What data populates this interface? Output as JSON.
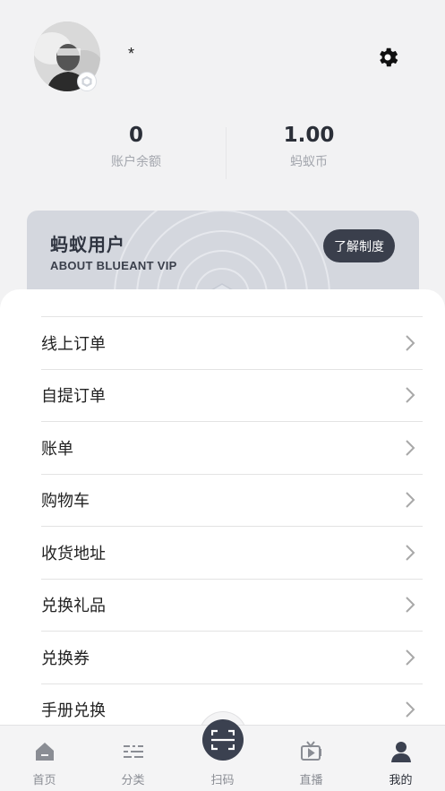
{
  "profile": {
    "nickname": "*"
  },
  "stats": {
    "balance_value": "0",
    "balance_label": "账户余额",
    "coins_value": "1.00",
    "coins_label": "蚂蚁币"
  },
  "vip": {
    "title": "蚂蚁用户",
    "subtitle": "ABOUT BLUEANT VIP",
    "button": "了解制度"
  },
  "menu": [
    {
      "label": "线上订单"
    },
    {
      "label": "自提订单"
    },
    {
      "label": "账单"
    },
    {
      "label": "购物车"
    },
    {
      "label": "收货地址"
    },
    {
      "label": "兑换礼品"
    },
    {
      "label": "兑换券"
    },
    {
      "label": "手册兑换"
    }
  ],
  "tabbar": {
    "items": [
      {
        "label": "首页",
        "icon": "home-icon"
      },
      {
        "label": "分类",
        "icon": "category-icon"
      },
      {
        "label": "扫码",
        "icon": "scan-icon"
      },
      {
        "label": "直播",
        "icon": "live-tv-icon"
      },
      {
        "label": "我的",
        "icon": "person-icon"
      }
    ],
    "active": "我的"
  },
  "colors": {
    "accent": "#3b4150",
    "vip_card": "#d4d7de",
    "background": "#f2f2f3"
  }
}
